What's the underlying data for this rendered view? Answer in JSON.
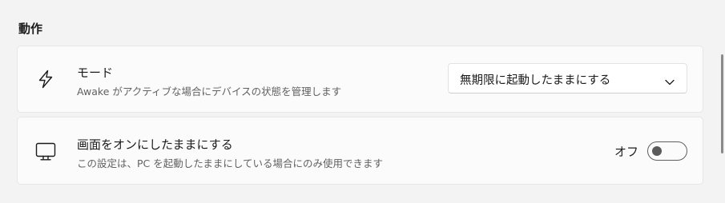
{
  "section": {
    "title": "動作"
  },
  "mode_card": {
    "icon": "lightning-icon",
    "title": "モード",
    "description": "Awake がアクティブな場合にデバイスの状態を管理します",
    "dropdown": {
      "selected": "無期限に起動したままにする"
    }
  },
  "screen_card": {
    "icon": "monitor-icon",
    "title": "画面をオンにしたままにする",
    "description": "この設定は、PC を起動したままにしている場合にのみ使用できます",
    "toggle": {
      "label": "オフ",
      "state": "off"
    }
  },
  "colors": {
    "page_background": "#f3f3f3",
    "card_background": "#fbfbfb",
    "text_primary": "#1b1b1b",
    "text_secondary": "#616161"
  }
}
